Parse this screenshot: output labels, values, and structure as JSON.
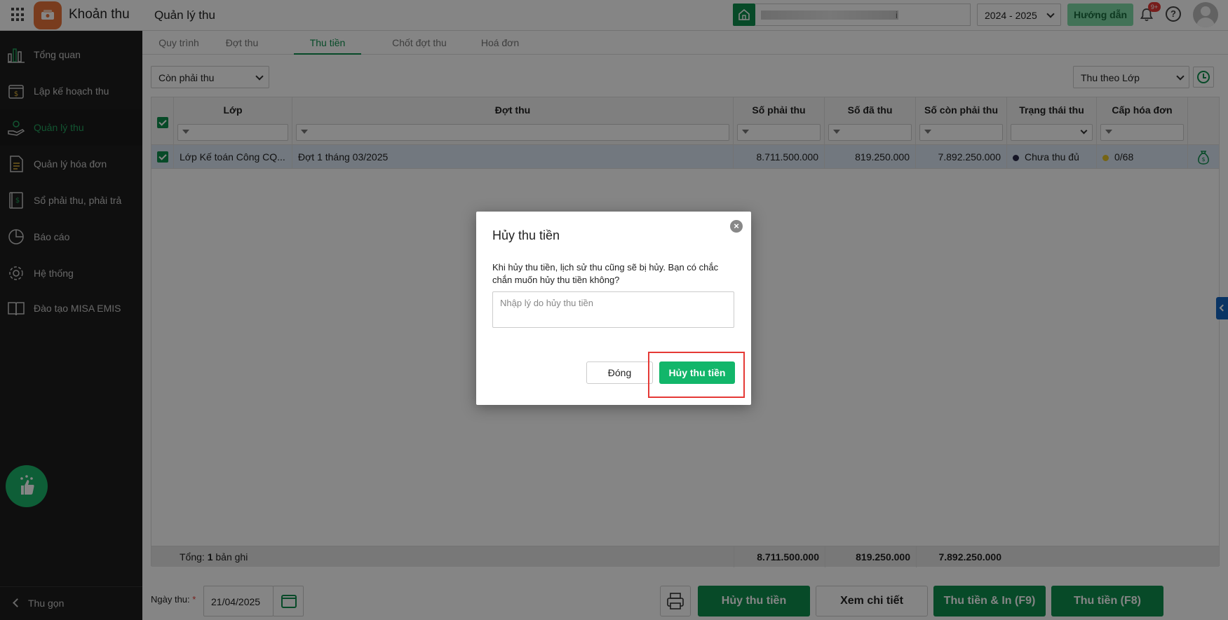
{
  "app": {
    "name": "Khoản thu",
    "page_title": "Quản lý thu"
  },
  "header": {
    "school_visible_suffix": "i",
    "school_year": "2024 - 2025",
    "guide_label": "Hướng dẫn",
    "notification_badge": "9+"
  },
  "sidebar": {
    "items": [
      {
        "label": "Tổng quan",
        "icon": "bar-chart-icon"
      },
      {
        "label": "Lập kế hoạch thu",
        "icon": "calendar-money-icon"
      },
      {
        "label": "Quản lý thu",
        "icon": "hand-coin-icon",
        "active": true
      },
      {
        "label": "Quản lý hóa đơn",
        "icon": "document-icon"
      },
      {
        "label": "Sổ phải thu, phải trả",
        "icon": "ledger-book-icon"
      },
      {
        "label": "Báo cáo",
        "icon": "pie-chart-icon"
      },
      {
        "label": "Hệ thống",
        "icon": "gear-icon"
      },
      {
        "label": "Đào tạo MISA EMIS",
        "icon": "open-book-icon"
      }
    ],
    "collapse_label": "Thu gọn"
  },
  "tabs": [
    {
      "label": "Quy trình"
    },
    {
      "label": "Đợt thu"
    },
    {
      "label": "Thu tiền",
      "active": true
    },
    {
      "label": "Chốt đợt thu"
    },
    {
      "label": "Hoá đơn"
    }
  ],
  "toolbar": {
    "status_filter": "Còn phải thu",
    "group_by": "Thu theo Lớp"
  },
  "table": {
    "columns": [
      "Lớp",
      "Đợt thu",
      "Số phải thu",
      "Số đã thu",
      "Số còn phải thu",
      "Trạng thái thu",
      "Cấp hóa đơn"
    ],
    "rows": [
      {
        "class": "Lớp Kế toán Công CQ...",
        "period": "Đợt 1 tháng 03/2025",
        "receivable": "8.711.500.000",
        "collected": "819.250.000",
        "remaining": "7.892.250.000",
        "status": "Chưa thu đủ",
        "invoice": "0/68"
      }
    ],
    "footer": {
      "total_prefix": "Tổng: ",
      "total_count": "1",
      "total_suffix": " bản ghi",
      "receivable": "8.711.500.000",
      "collected": "819.250.000",
      "remaining": "7.892.250.000"
    }
  },
  "bottom": {
    "date_label": "Ngày thu:",
    "date_required": "*",
    "date_value": "21/04/2025",
    "cancel_label": "Hủy thu tiền",
    "detail_label": "Xem chi tiết",
    "collect_print_label": "Thu tiền & In (F9)",
    "collect_label": "Thu tiền (F8)"
  },
  "dialog": {
    "title": "Hủy thu tiền",
    "message": "Khi hủy thu tiền, lịch sử thu cũng sẽ bị hủy. Bạn có chắc chắn muốn hủy thu tiền không?",
    "reason_placeholder": "Nhập lý do hủy thu tiền",
    "close_label": "Đóng",
    "confirm_label": "Hủy thu tiền"
  },
  "colors": {
    "primary": "#0e8f4d",
    "confirm": "#12b66a",
    "sidebar_bg": "#1d1d1d",
    "highlight": "#e53935",
    "status_dot": "#2b2b4a",
    "invoice_dot": "#e2c12a"
  }
}
